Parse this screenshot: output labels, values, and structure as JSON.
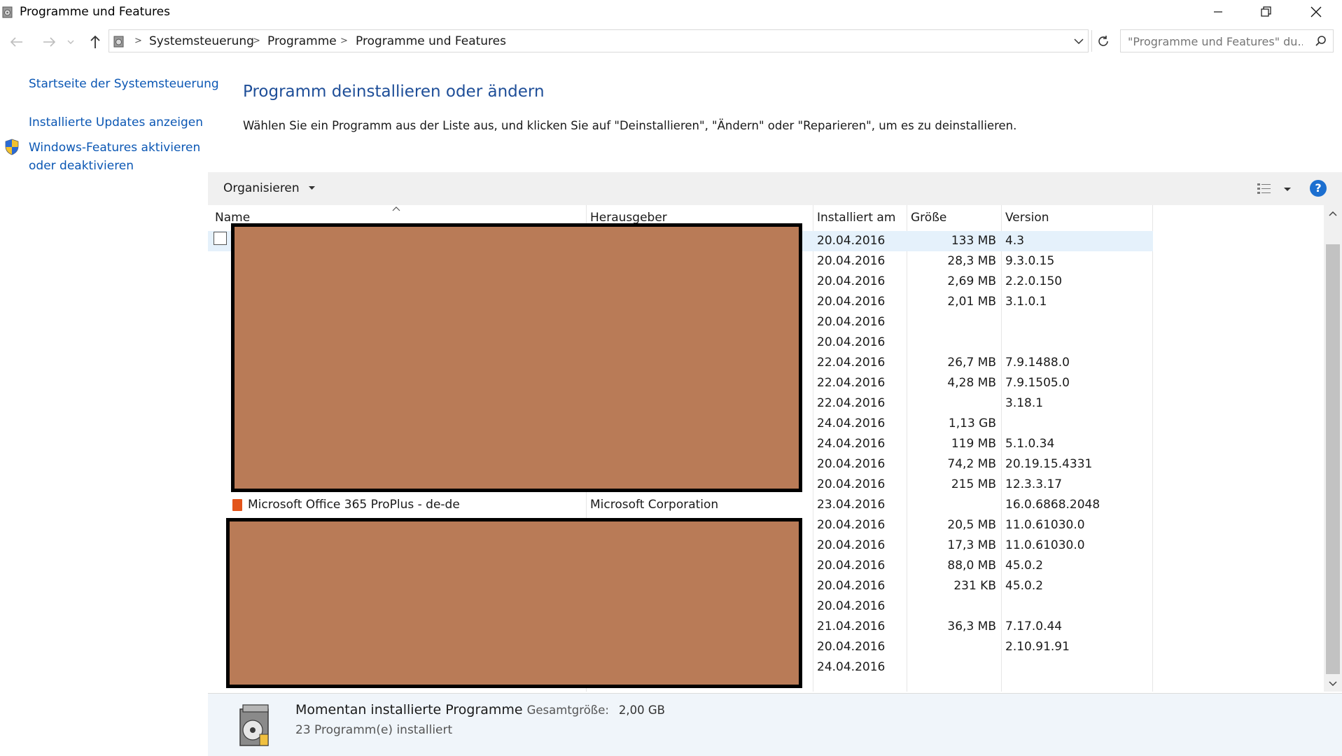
{
  "window": {
    "title": "Programme und Features",
    "controls": [
      "minimize",
      "restore",
      "close"
    ]
  },
  "address": {
    "crumbs": [
      "Systemsteuerung",
      "Programme",
      "Programme und Features"
    ],
    "search_placeholder": "\"Programme und Features\" du..."
  },
  "sidebar": {
    "links": [
      {
        "label": "Startseite der Systemsteuerung"
      },
      {
        "label": "Installierte Updates anzeigen"
      },
      {
        "label": "Windows-Features aktivieren oder deaktivieren",
        "line1": "Windows-Features aktivieren",
        "line2": "oder deaktivieren",
        "icon": "shield-icon"
      }
    ]
  },
  "main": {
    "heading": "Programm deinstallieren oder ändern",
    "description": "Wählen Sie ein Programm aus der Liste aus, und klicken Sie auf \"Deinstallieren\", \"Ändern\" oder \"Reparieren\", um es zu deinstallieren.",
    "toolbar": {
      "organize": "Organisieren"
    }
  },
  "list": {
    "columns": [
      "Name",
      "Herausgeber",
      "Installiert am",
      "Größe",
      "Version"
    ],
    "sort_column": "Name",
    "rows": [
      {
        "date": "20.04.2016",
        "size": "133 MB",
        "version": "4.3",
        "selected": true
      },
      {
        "date": "20.04.2016",
        "size": "28,3 MB",
        "version": "9.3.0.15"
      },
      {
        "date": "20.04.2016",
        "size": "2,69 MB",
        "version": "2.2.0.150"
      },
      {
        "date": "20.04.2016",
        "size": "2,01 MB",
        "version": "3.1.0.1"
      },
      {
        "date": "20.04.2016",
        "size": "",
        "version": ""
      },
      {
        "date": "20.04.2016",
        "size": "",
        "version": ""
      },
      {
        "date": "22.04.2016",
        "size": "26,7 MB",
        "version": "7.9.1488.0"
      },
      {
        "date": "22.04.2016",
        "size": "4,28 MB",
        "version": "7.9.1505.0"
      },
      {
        "date": "22.04.2016",
        "size": "",
        "version": "3.18.1"
      },
      {
        "date": "24.04.2016",
        "size": "1,13 GB",
        "version": ""
      },
      {
        "date": "24.04.2016",
        "size": "119 MB",
        "version": "5.1.0.34"
      },
      {
        "date": "20.04.2016",
        "size": "74,2 MB",
        "version": "20.19.15.4331"
      },
      {
        "date": "20.04.2016",
        "size": "215 MB",
        "version": "12.3.3.17"
      },
      {
        "name": "Microsoft Office 365 ProPlus - de-de",
        "publisher": "Microsoft Corporation",
        "date": "23.04.2016",
        "size": "",
        "version": "16.0.6868.2048",
        "icon": "office-icon"
      },
      {
        "date": "20.04.2016",
        "size": "20,5 MB",
        "version": "11.0.61030.0"
      },
      {
        "date": "20.04.2016",
        "size": "17,3 MB",
        "version": "11.0.61030.0"
      },
      {
        "date": "20.04.2016",
        "size": "88,0 MB",
        "version": "45.0.2"
      },
      {
        "date": "20.04.2016",
        "size": "231 KB",
        "version": "45.0.2"
      },
      {
        "date": "20.04.2016",
        "size": "",
        "version": ""
      },
      {
        "date": "21.04.2016",
        "size": "36,3 MB",
        "version": "7.17.0.44"
      },
      {
        "date": "20.04.2016",
        "size": "",
        "version": "2.10.91.91"
      },
      {
        "date": "24.04.2016",
        "size": "",
        "version": ""
      }
    ]
  },
  "status": {
    "title": "Momentan installierte Programme",
    "total_label": "Gesamtgröße:",
    "total_value": "2,00 GB",
    "count": "23 Programm(e) installiert"
  },
  "colors": {
    "link": "#0b57b4",
    "heading": "#1e4e98",
    "redaction": "#b97b57",
    "selection": "#e5f1fb"
  }
}
